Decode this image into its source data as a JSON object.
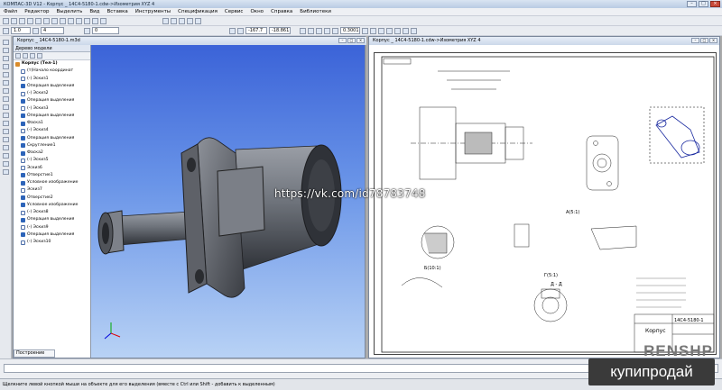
{
  "app": {
    "title": "КОМПАС-3D V12 - Корпус _ 14С4-5180-1.cdw->Изометрия XYZ 4"
  },
  "menu": [
    "Файл",
    "Редактор",
    "Выделить",
    "Вид",
    "Вставка",
    "Инструменты",
    "Спецификация",
    "Сервис",
    "Окно",
    "Справка",
    "Библиотеки"
  ],
  "toolbar": {
    "scale_value": "1.0",
    "layer_value": "4",
    "step_value": "0",
    "coord_x": "-167.7",
    "coord_y": "-18.861",
    "zoom_value": "0.3001"
  },
  "window3d": {
    "title": "Корпус _ 14С4-5180-1.m3d"
  },
  "tree": {
    "header": "Дерево модели",
    "tab_label": "Построение",
    "items": [
      "Корпус (Тел-1)",
      "(т)Начало координат",
      "(-) Эскиз1",
      "Операция выделения",
      "(-) Эскиз2",
      "Операция выделения",
      "(-) Эскиз3",
      "Операция выделения",
      "Фаска1",
      "(-) Эскиз4",
      "Операция выделения",
      "Скругление1",
      "Фаска2",
      "(-) Эскиз5",
      "Эскиз6",
      "Отверстие1",
      "Условное изображение",
      "Эскиз7",
      "Отверстие2",
      "Условное изображение",
      "(-) Эскиз8",
      "Операция выделения",
      "(-) Эскиз9",
      "Операция выделения",
      "(-) Эскиз10"
    ]
  },
  "window2d": {
    "title": "Корпус _ 14С4-5180-1.cdw->Изометрия XYZ 4"
  },
  "drawing": {
    "stamp_name": "Корпус",
    "stamp_code": "14С4-5180-1",
    "view_a": "А(5:1)",
    "view_b": "Б(10:1)",
    "view_c": "Г(5:1)",
    "section_label": "Д - Д"
  },
  "status_text": "Щелкните левой кнопкой мыши на объекте для его выделения (вместе с Ctrl или Shift - добавить к выделенным)",
  "watermark": "https://vk.com/id78783748",
  "brand": "купипродай",
  "brand_logo": "RENSHP"
}
